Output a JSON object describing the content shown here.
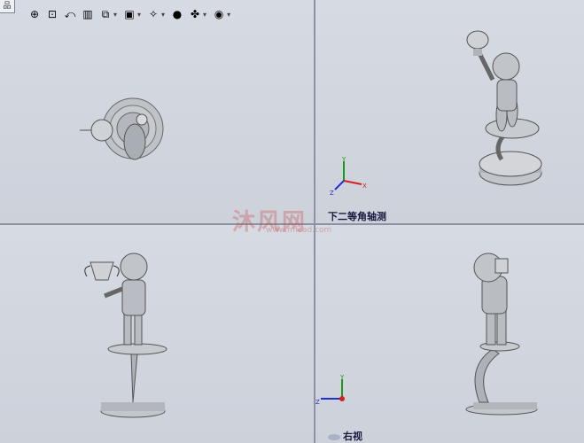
{
  "corner_tab": "品",
  "toolbar": {
    "buttons": [
      {
        "icon": "zoom-fit-icon",
        "glyph": "⊕",
        "has_arrow": false
      },
      {
        "icon": "zoom-area-icon",
        "glyph": "⊡",
        "has_arrow": false
      },
      {
        "icon": "previous-view-icon",
        "glyph": "⤺",
        "has_arrow": false
      },
      {
        "icon": "section-view-icon",
        "glyph": "▥",
        "has_arrow": false
      },
      {
        "icon": "view-orientation-icon",
        "glyph": "⧉",
        "has_arrow": true
      },
      {
        "icon": "display-style-icon",
        "glyph": "▣",
        "has_arrow": true
      },
      {
        "icon": "hide-show-icon",
        "glyph": "✧",
        "has_arrow": true
      },
      {
        "icon": "appearance-icon",
        "glyph": "●",
        "has_arrow": false
      },
      {
        "icon": "scene-icon",
        "glyph": "✤",
        "has_arrow": true
      },
      {
        "icon": "view-settings-icon",
        "glyph": "◉",
        "has_arrow": true
      }
    ]
  },
  "views": {
    "top_right_label": "下二等角轴测",
    "bottom_right_label": "右视"
  },
  "watermark": {
    "text": "沐风网",
    "sub": "www.mfcad.com"
  },
  "colors": {
    "background": "#cdd1da",
    "model": "#b9bcc2",
    "axis_x": "#d42020",
    "axis_y": "#1a9a1a",
    "axis_z": "#2030d0"
  }
}
